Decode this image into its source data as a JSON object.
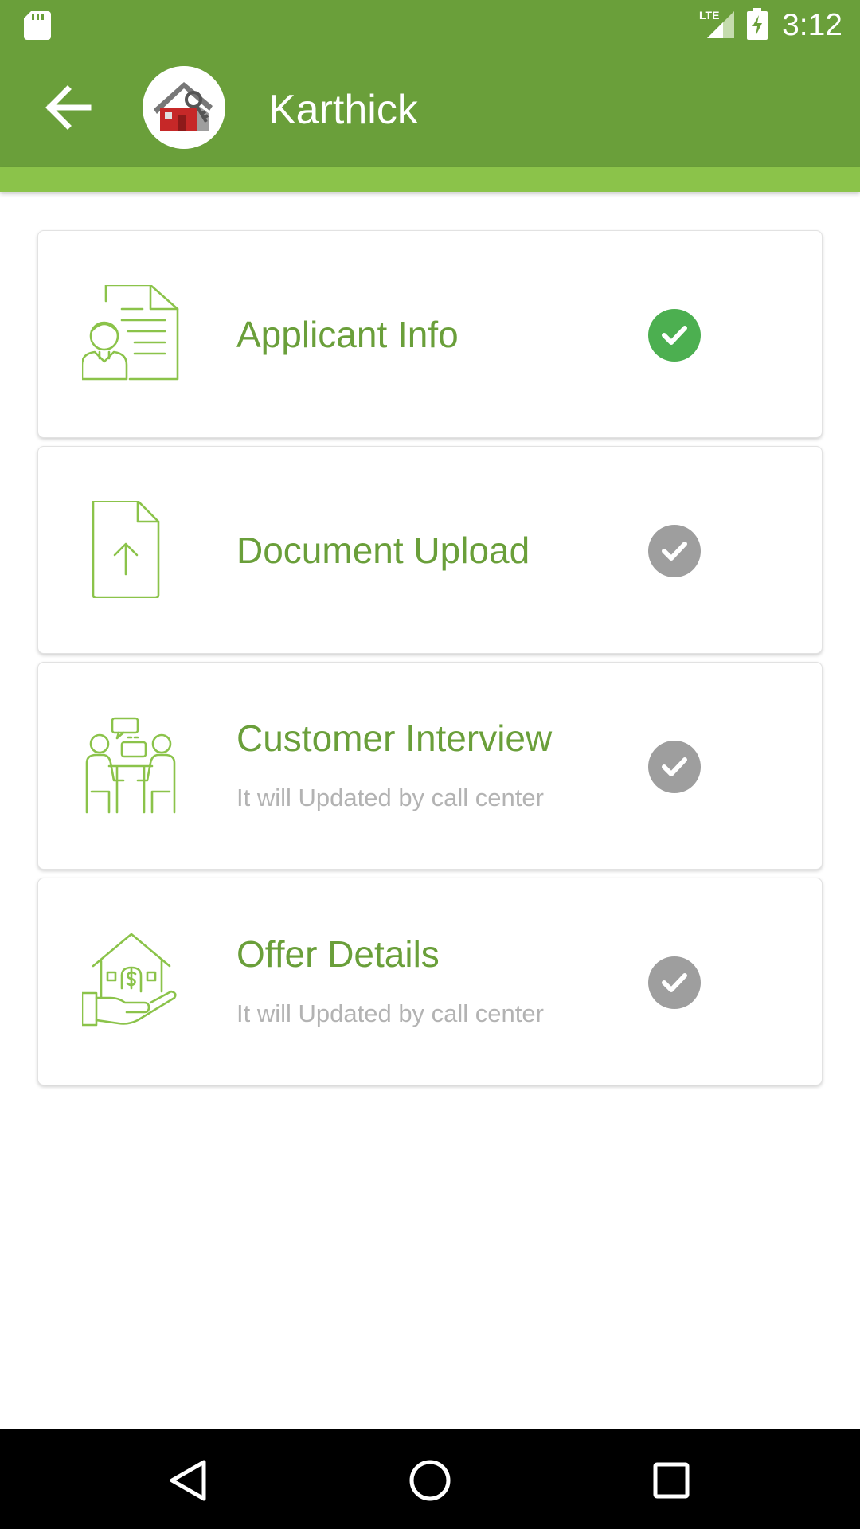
{
  "status_bar": {
    "time": "3:12",
    "network_label": "LTE"
  },
  "toolbar": {
    "title": "Karthick",
    "back_icon": "arrow-left-icon",
    "avatar_icon": "house-key-icon"
  },
  "colors": {
    "primary": "#6a9f3a",
    "accent": "#8bc34a",
    "done": "#4caf50",
    "pending": "#9e9e9e",
    "subtitle": "#b3b3b3"
  },
  "steps": [
    {
      "title": "Applicant Info",
      "subtitle": "",
      "icon": "applicant-document-icon",
      "status": "done"
    },
    {
      "title": "Document Upload",
      "subtitle": "",
      "icon": "file-upload-icon",
      "status": "pending"
    },
    {
      "title": "Customer Interview",
      "subtitle": "It will Updated by call center",
      "icon": "interview-icon",
      "status": "pending"
    },
    {
      "title": "Offer Details",
      "subtitle": "It will Updated by call center",
      "icon": "house-offer-icon",
      "status": "pending"
    }
  ],
  "nav": {
    "back": "nav-back-icon",
    "home": "nav-home-icon",
    "recents": "nav-recents-icon"
  }
}
